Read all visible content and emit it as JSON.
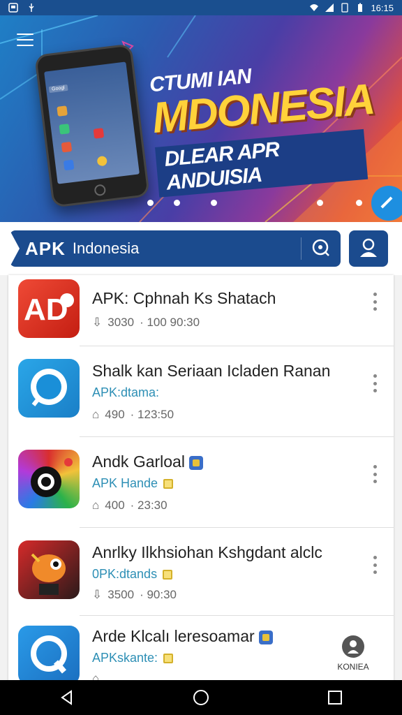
{
  "status_bar": {
    "time": "16:15",
    "icons": [
      "notification-icon",
      "usb-icon",
      "wifi-icon",
      "signal-icon",
      "sim-icon",
      "battery-icon"
    ]
  },
  "banner": {
    "line1": "CTUMI IAN",
    "line2": "MDONESIA",
    "line3": "DLEAR APR ANDUISIA",
    "phone_search_label": "Googl",
    "active_slide": 1,
    "slide_count": 6
  },
  "search": {
    "brand": "APK",
    "title": "Indonesia"
  },
  "apps": [
    {
      "title": "APK: Cphnah Ks Shatach",
      "developer": "",
      "size": "3030",
      "extra": "· 100 90:30",
      "meta_icon": "download-icon",
      "icon_colors": [
        "#e5392b",
        "#c42115"
      ],
      "icon_name": "app-icon-ad",
      "badge": ""
    },
    {
      "title": "Shalk kan Seriaan Icladen Ranan",
      "developer": "APK:dtama:",
      "size": "490",
      "extra": "· 123:50",
      "meta_icon": "home-icon",
      "icon_colors": [
        "#2aa6e8",
        "#1a7fc7"
      ],
      "icon_name": "app-icon-chat",
      "badge": ""
    },
    {
      "title": "Andk Garloal",
      "developer": "APK Hande",
      "size": "400",
      "extra": "· 23:30",
      "meta_icon": "home-icon",
      "icon_colors": [
        "#d92e2e",
        "#2bb24a"
      ],
      "icon_name": "app-icon-lens",
      "badge": "blue"
    },
    {
      "title": "Anrlky Ilkhsiohan Kshgdant alclc",
      "developer": "0PK:dtands",
      "size": "3500",
      "extra": "· 90:30",
      "meta_icon": "download-icon",
      "icon_colors": [
        "#e86b2a",
        "#2a1a1a"
      ],
      "icon_name": "app-icon-robot",
      "badge": ""
    },
    {
      "title": "Arde Klcalı leresoamar",
      "developer": "APKskante:",
      "size": "",
      "extra": "",
      "meta_icon": "home-icon",
      "icon_colors": [
        "#2a9ae8",
        "#1b6fc0"
      ],
      "icon_name": "app-icon-q",
      "badge": "blue"
    }
  ],
  "profile_fab": {
    "label": "KONIEA"
  },
  "nav": {
    "back": "back-icon",
    "home": "home-circle-icon",
    "recents": "recents-icon"
  }
}
